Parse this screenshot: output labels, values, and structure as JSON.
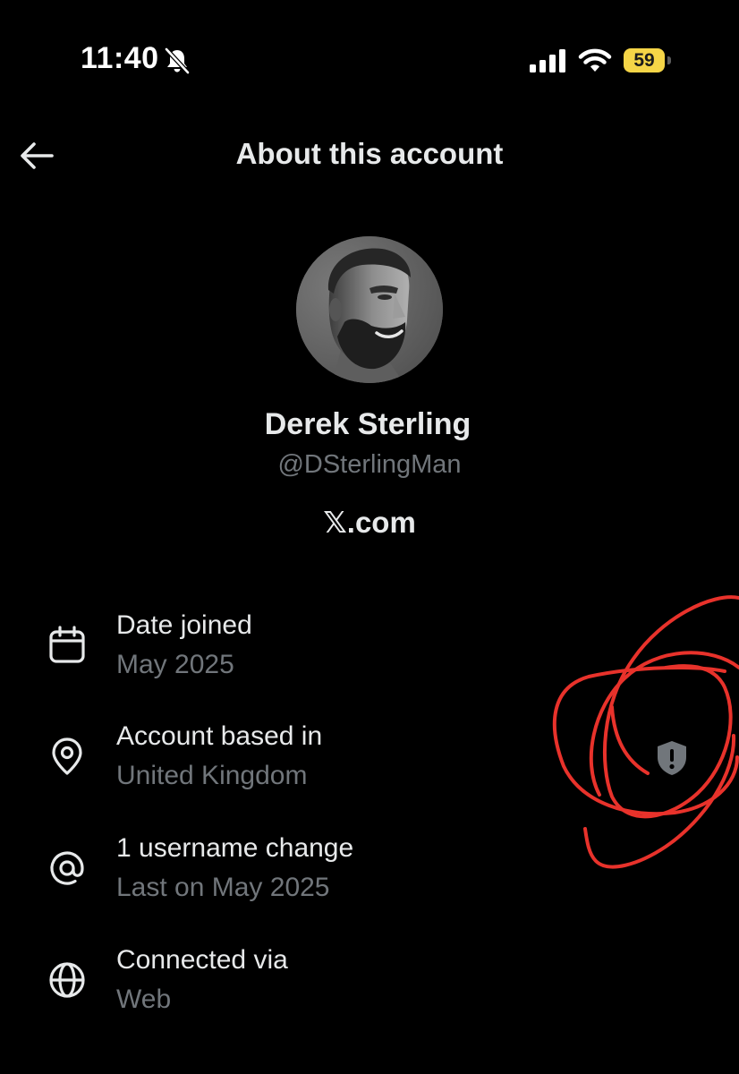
{
  "status_bar": {
    "time": "11:40",
    "battery_level": "59",
    "icons": [
      "bell-off-icon",
      "signal-icon",
      "wifi-icon",
      "battery-icon"
    ],
    "battery_color": "#f5d547"
  },
  "header": {
    "back_icon": "arrow-left-icon",
    "title": "About this account"
  },
  "profile": {
    "display_name": "Derek Sterling",
    "handle": "@DSterlingMan",
    "site": "𝕏.com"
  },
  "details": [
    {
      "icon": "calendar-icon",
      "label": "Date joined",
      "value": "May 2025"
    },
    {
      "icon": "location-pin-icon",
      "label": "Account based in",
      "value": "United Kingdom",
      "trailing_icon": "shield-alert-icon"
    },
    {
      "icon": "at-sign-icon",
      "label": "1 username change",
      "value": "Last on May 2025"
    },
    {
      "icon": "globe-icon",
      "label": "Connected via",
      "value": "Web"
    }
  ],
  "colors": {
    "background": "#000000",
    "primary_text": "#e7e9ea",
    "secondary_text": "#71767b",
    "annotation": "#e8322b"
  }
}
